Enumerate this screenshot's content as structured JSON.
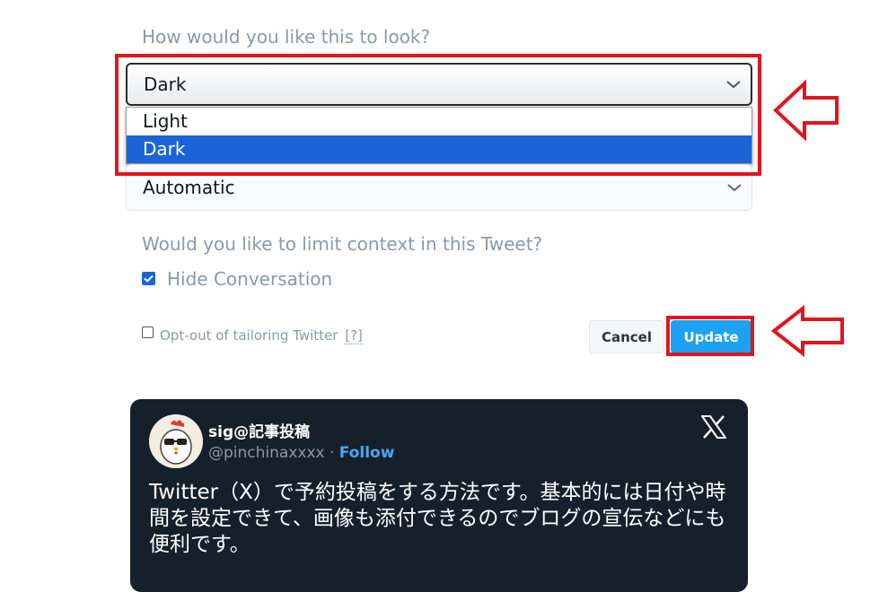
{
  "theme_question": "How would you like this to look?",
  "theme_select": {
    "value": "Dark",
    "options": [
      "Light",
      "Dark"
    ],
    "selected_option": "Dark"
  },
  "language_select": {
    "value": "Automatic"
  },
  "context_question": "Would you like to limit context in this Tweet?",
  "hide_conversation": {
    "label": "Hide Conversation",
    "checked": true
  },
  "optout": {
    "label": "Opt-out of tailoring Twitter",
    "help_link": "[?]",
    "checked": false
  },
  "buttons": {
    "cancel": "Cancel",
    "update": "Update"
  },
  "annotation_color": "#e3141e",
  "tweet": {
    "display_name": "sig@記事投稿",
    "handle": "@pinchinaxxxx",
    "separator": "·",
    "follow_label": "Follow",
    "text": "Twitter（X）で予約投稿をする方法です。基本的には日付や時間を設定できて、画像も添付できるのでブログの宣伝などにも便利です。",
    "logo_icon": "x-logo-icon",
    "avatar_icon": "chicken-avatar"
  }
}
